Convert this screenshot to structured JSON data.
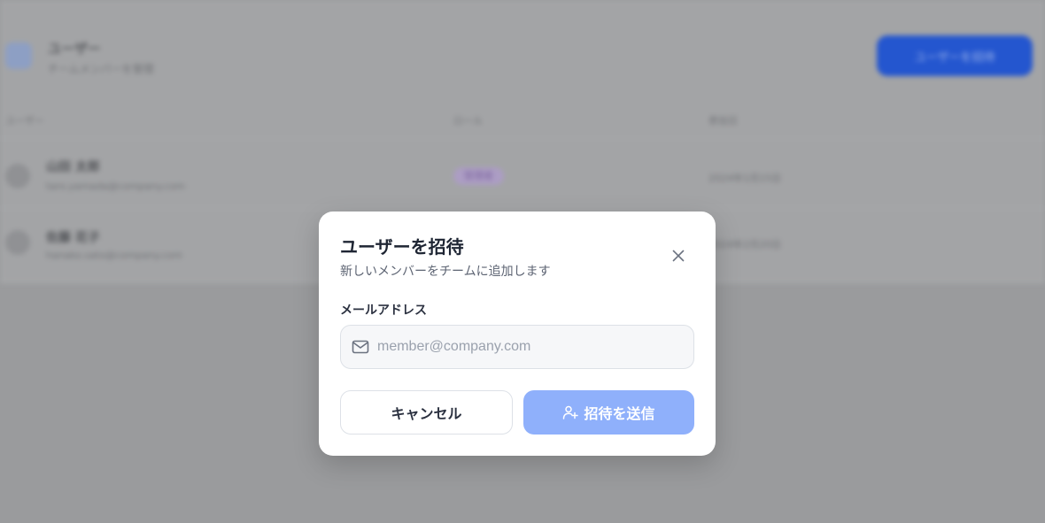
{
  "background": {
    "app_title": "ユーザー",
    "app_subtitle": "チームメンバーを管理",
    "invite_button_label": "ユーザーを招待",
    "columns": [
      "ユーザー",
      "ロール",
      "参加日"
    ],
    "rows": [
      {
        "name": "山田 太郎",
        "email": "taro.yamada@company.com",
        "role": "管理者",
        "joined": "2024年1月15日"
      },
      {
        "name": "佐藤 花子",
        "email": "hanako.sato@company.com",
        "role": "",
        "joined": "2024年2月20日"
      }
    ],
    "colors": {
      "overlay": "#9a9b9d",
      "accent": "#2456cf",
      "role_badge": "#ac9dc4"
    }
  },
  "modal": {
    "title": "ユーザーを招待",
    "subtitle": "新しいメンバーをチームに追加します",
    "email_label": "メールアドレス",
    "email_value": "",
    "email_placeholder": "member@company.com",
    "cancel_label": "キャンセル",
    "send_label": "招待を送信",
    "icons": {
      "close": "close-icon",
      "mail": "mail-icon",
      "send": "user-plus-icon"
    },
    "colors": {
      "send_button": "#8fb0fb",
      "title": "#1e2533",
      "input_bg": "#f6f7f9"
    }
  }
}
